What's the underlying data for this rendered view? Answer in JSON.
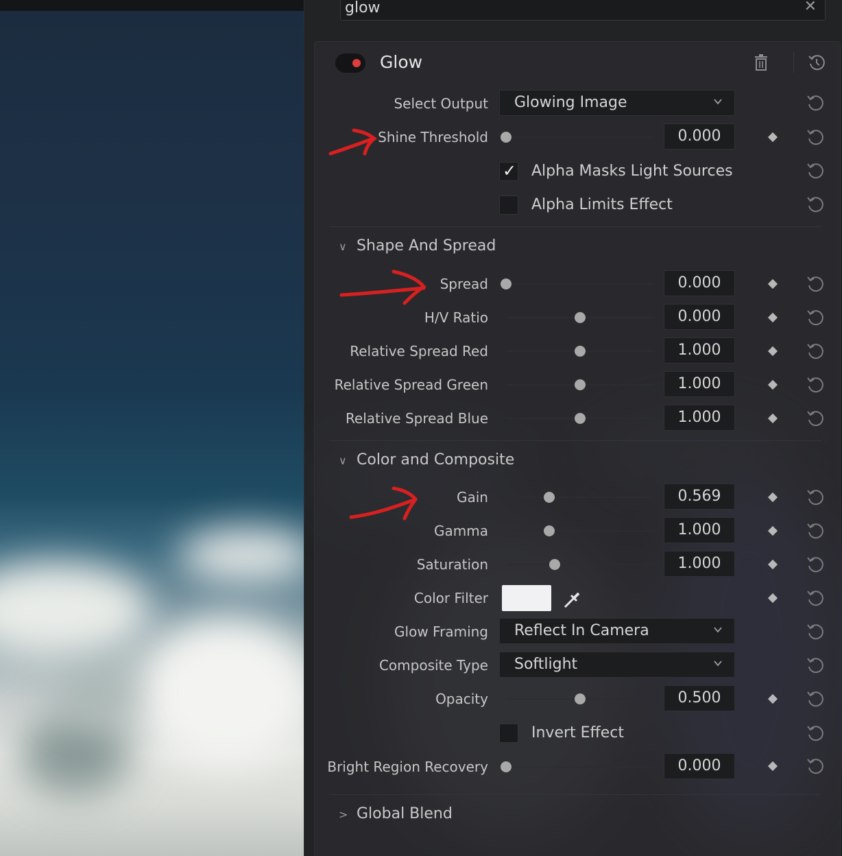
{
  "search": {
    "value": "glow",
    "close_glyph": "✕"
  },
  "effect": {
    "title": "Glow",
    "enabled": true,
    "toggle_color": "#e23d3d"
  },
  "controls": {
    "select_output": {
      "label": "Select Output",
      "value": "Glowing Image"
    },
    "shine_threshold": {
      "label": "Shine Threshold",
      "value": "0.000",
      "slider": 0.0
    },
    "alpha_masks": {
      "label": "Alpha Masks Light Sources",
      "checked": true,
      "tick": "✓"
    },
    "alpha_limits": {
      "label": "Alpha Limits Effect",
      "checked": false
    }
  },
  "sections": {
    "shape": {
      "title": "Shape And Spread",
      "expanded": true,
      "rows": [
        {
          "label": "Spread",
          "value": "0.000",
          "slider": 0.0
        },
        {
          "label": "H/V Ratio",
          "value": "0.000",
          "slider": 0.5
        },
        {
          "label": "Relative Spread Red",
          "value": "1.000",
          "slider": 0.5
        },
        {
          "label": "Relative Spread Green",
          "value": "1.000",
          "slider": 0.5
        },
        {
          "label": "Relative Spread Blue",
          "value": "1.000",
          "slider": 0.5
        }
      ]
    },
    "color": {
      "title": "Color and Composite",
      "expanded": true,
      "gain": {
        "label": "Gain",
        "value": "0.569",
        "slider": 0.29
      },
      "gamma": {
        "label": "Gamma",
        "value": "1.000",
        "slider": 0.29
      },
      "saturation": {
        "label": "Saturation",
        "value": "1.000",
        "slider": 0.33
      },
      "color_filter": {
        "label": "Color Filter",
        "swatch": "#f1f1f3"
      },
      "glow_framing": {
        "label": "Glow Framing",
        "value": "Reflect In Camera"
      },
      "composite_type": {
        "label": "Composite Type",
        "value": "Softlight"
      },
      "opacity": {
        "label": "Opacity",
        "value": "0.500",
        "slider": 0.5
      },
      "invert_effect": {
        "label": "Invert Effect",
        "checked": false
      },
      "bright_region": {
        "label": "Bright Region Recovery",
        "value": "0.000",
        "slider": 0.0
      }
    },
    "global_blend": {
      "title": "Global Blend",
      "expanded": false
    }
  },
  "glyphs": {
    "expanded": "∨",
    "collapsed": ">"
  },
  "annotation_color": "#d92020"
}
